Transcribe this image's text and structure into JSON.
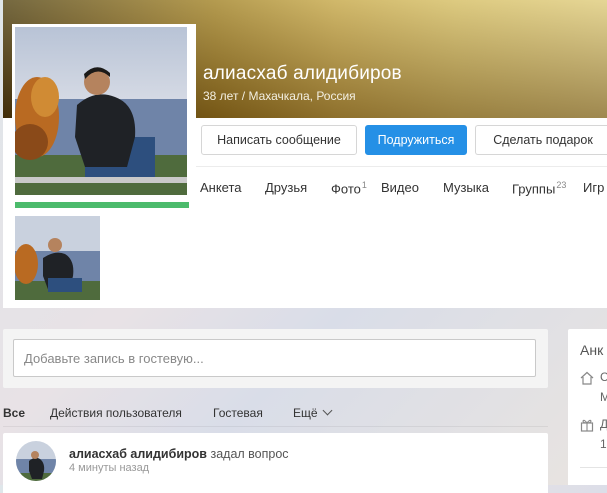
{
  "profile": {
    "name": "алиасхаб алидибиров",
    "subtitle": "38 лет / Махачкала, Россия"
  },
  "actions": {
    "message": "Написать сообщение",
    "friend": "Подружиться",
    "gift": "Сделать подарок"
  },
  "tabs": [
    {
      "label": "Анкета",
      "count": ""
    },
    {
      "label": "Друзья",
      "count": ""
    },
    {
      "label": "Фото",
      "count": "1"
    },
    {
      "label": "Видео",
      "count": ""
    },
    {
      "label": "Музыка",
      "count": ""
    },
    {
      "label": "Группы",
      "count": "23"
    },
    {
      "label": "Игр",
      "count": ""
    }
  ],
  "guestbook": {
    "placeholder": "Добавьте запись в гостевую..."
  },
  "filters": [
    {
      "label": "Все",
      "active": true
    },
    {
      "label": "Действия пользователя",
      "active": false
    },
    {
      "label": "Гостевая",
      "active": false
    },
    {
      "label": "Ещё",
      "active": false
    }
  ],
  "feed": {
    "author": "алиасхаб алидибиров",
    "action": "задал вопрос",
    "time": "4 минуты назад"
  },
  "sidebar": {
    "title": "Анк",
    "row1_a": "С",
    "row1_b": "М",
    "row2_a": "Д",
    "row2_b": "1"
  },
  "colors": {
    "accent": "#2590e6",
    "online": "#4cbb6c"
  }
}
